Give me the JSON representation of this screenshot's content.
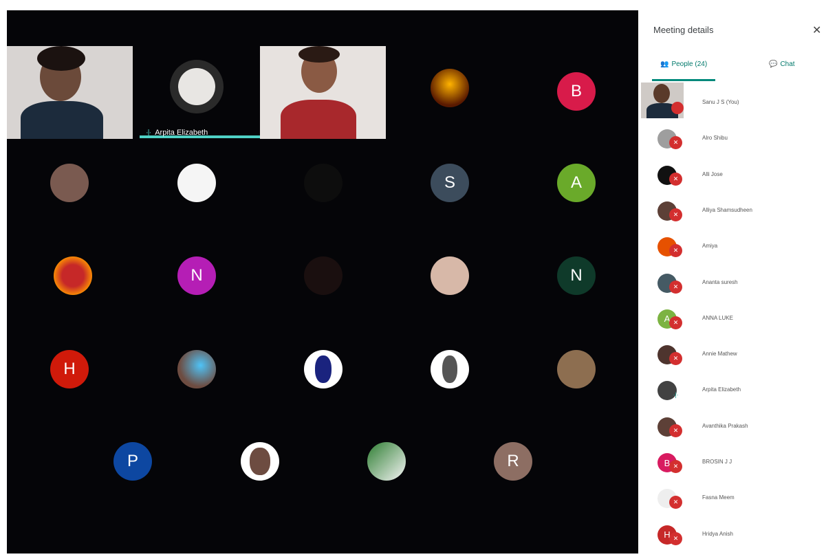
{
  "colors": {
    "grid_bg": "#050508",
    "accent": "#4fd1c5",
    "mic_off": "#d32f2f",
    "panel_tab": "#00796b"
  },
  "tiles": {
    "speaker_name": "Arpita Elizabeth",
    "avatars": {
      "b": "B",
      "s": "S",
      "a": "A",
      "n1": "N",
      "n2": "N",
      "h": "H",
      "p": "P",
      "r": "R"
    }
  },
  "panel": {
    "title": "Meeting details",
    "close_icon": "close-icon",
    "tabs": {
      "people": "People (24)",
      "chat": "Chat"
    },
    "participants": [
      {
        "name": "Sanu J S (You)",
        "initial": "",
        "color": "#8d6e63"
      },
      {
        "name": "Alro Shibu",
        "initial": "",
        "color": "#9e9e9e"
      },
      {
        "name": "Alli Jose",
        "initial": "",
        "color": "#111111"
      },
      {
        "name": "Alliya Shamsudheen",
        "initial": "",
        "color": "#5d4037"
      },
      {
        "name": "Amiya",
        "initial": "",
        "color": "#e65100"
      },
      {
        "name": "Ananta suresh",
        "initial": "",
        "color": "#455a64"
      },
      {
        "name": "ANNA LUKE",
        "initial": "A",
        "color": "#7cb342"
      },
      {
        "name": "Annie Mathew",
        "initial": "",
        "color": "#4e342e"
      },
      {
        "name": "Arpita Elizabeth",
        "initial": "",
        "color": "#424242"
      },
      {
        "name": "Avanthika Prakash",
        "initial": "",
        "color": "#5d4037"
      },
      {
        "name": "BROSIN J J",
        "initial": "B",
        "color": "#d81b60"
      },
      {
        "name": "Fasna Meem",
        "initial": "",
        "color": "#eeeeee"
      },
      {
        "name": "Hridya Anish",
        "initial": "H",
        "color": "#c62828"
      }
    ]
  }
}
